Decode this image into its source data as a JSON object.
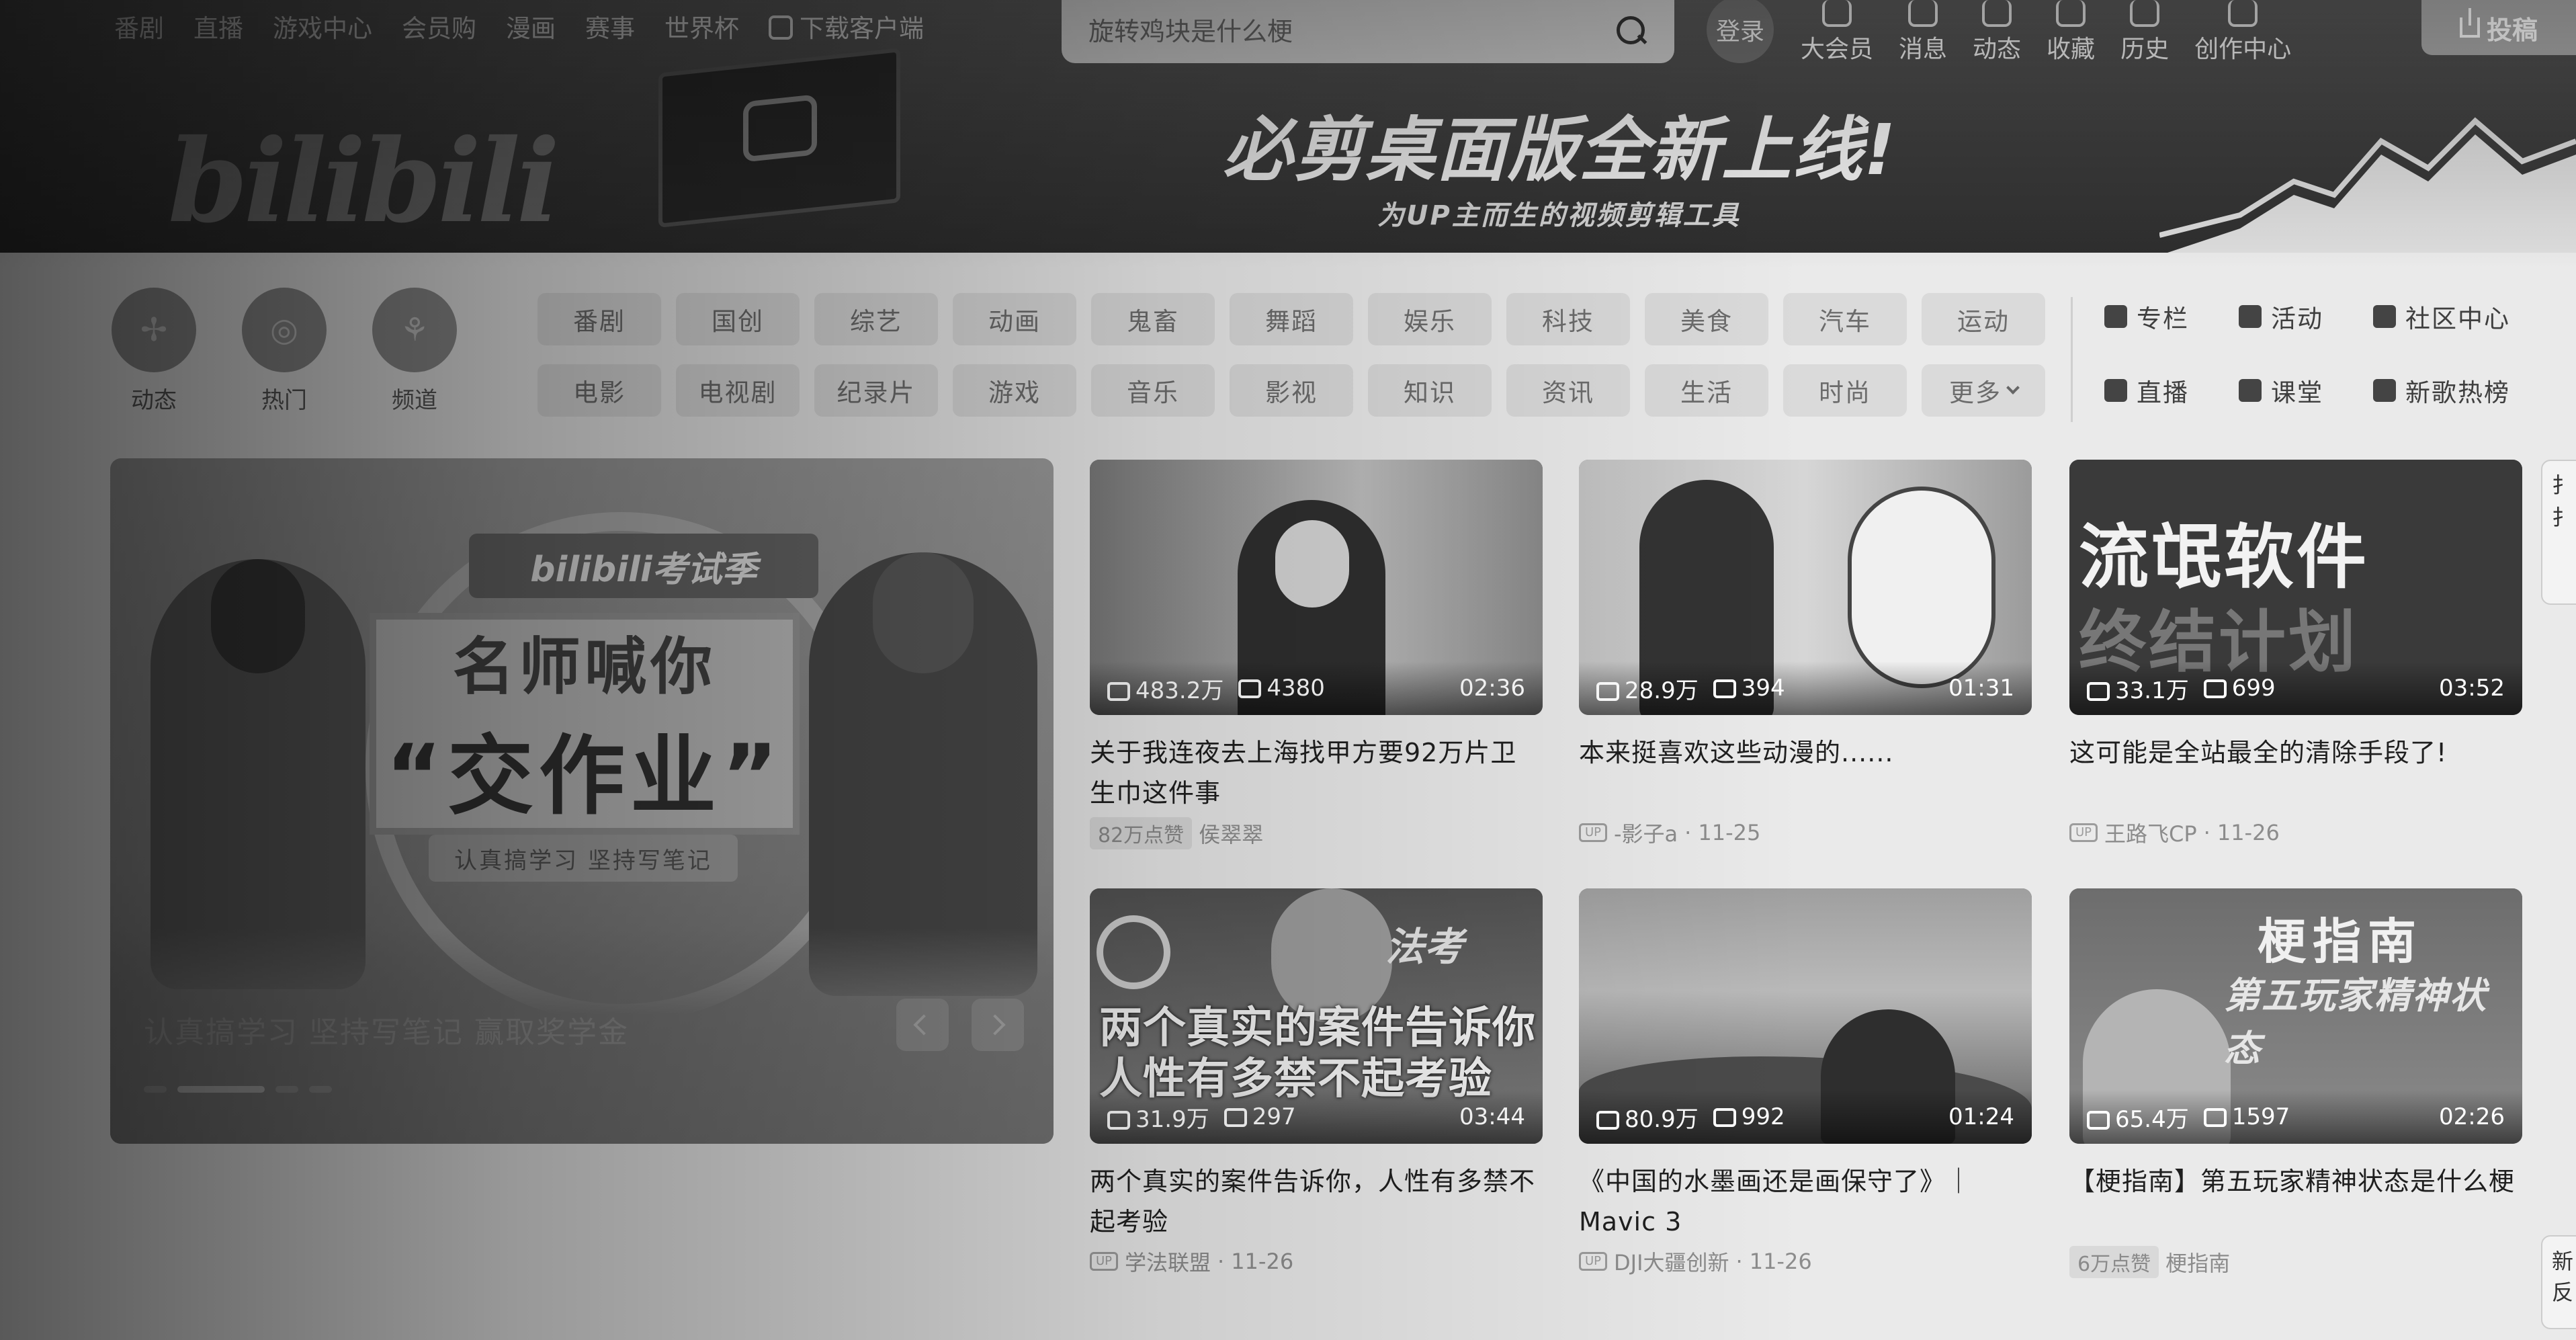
{
  "nav": {
    "links": [
      "番剧",
      "直播",
      "游戏中心",
      "会员购",
      "漫画",
      "赛事",
      "世界杯"
    ],
    "download": "下载客户端",
    "search_placeholder": "旋转鸡块是什么梗",
    "login": "登录",
    "icons": [
      {
        "label": "大会员",
        "icon": "vip-icon"
      },
      {
        "label": "消息",
        "icon": "message-icon"
      },
      {
        "label": "动态",
        "icon": "dynamic-icon"
      },
      {
        "label": "收藏",
        "icon": "favorite-icon"
      },
      {
        "label": "历史",
        "icon": "history-icon"
      },
      {
        "label": "创作中心",
        "icon": "creator-icon"
      }
    ],
    "upload": "投稿"
  },
  "banner": {
    "headline": "必剪桌面版全新上线!",
    "subline": "为UP主而生的视频剪辑工具",
    "logo": "bilibili"
  },
  "channels": {
    "circles": [
      "动态",
      "热门",
      "频道"
    ],
    "tags": [
      "番剧",
      "国创",
      "综艺",
      "动画",
      "鬼畜",
      "舞蹈",
      "娱乐",
      "科技",
      "美食",
      "汽车",
      "运动",
      "电影",
      "电视剧",
      "纪录片",
      "游戏",
      "音乐",
      "影视",
      "知识",
      "资讯",
      "生活",
      "时尚",
      "更多"
    ],
    "quick": [
      "专栏",
      "活动",
      "社区中心",
      "直播",
      "课堂",
      "新歌热榜"
    ]
  },
  "carousel": {
    "badge": "bilibili考试季",
    "board_line1": "名师喊你",
    "board_line2": "“交作业”",
    "ribbon": "认真搞学习 坚持写笔记",
    "caption": "认真搞学习 坚持写笔记 赢取奖学金"
  },
  "videos": [
    {
      "plays": "483.2万",
      "danmaku": "4380",
      "duration": "02:36",
      "title": "关于我连夜去上海找甲方要92万片卫生巾这件事",
      "likes": "82万点赞",
      "author": "侯翠翠",
      "date": ""
    },
    {
      "plays": "28.9万",
      "danmaku": "394",
      "duration": "01:31",
      "title": "本来挺喜欢这些动漫的......",
      "likes": "",
      "author": "-影子a",
      "date": "11-25"
    },
    {
      "plays": "33.1万",
      "danmaku": "699",
      "duration": "03:52",
      "title": "这可能是全站最全的清除手段了!",
      "likes": "",
      "author": "王路飞CP",
      "date": "11-26",
      "thumb_line1": "流氓软件",
      "thumb_line2": "终结计划"
    },
    {
      "plays": "31.9万",
      "danmaku": "297",
      "duration": "03:44",
      "title": "两个真实的案件告诉你，人性有多禁不起考验",
      "likes": "",
      "author": "学法联盟",
      "date": "11-26",
      "thumb_tag": "法考",
      "thumb_overlay": "两个真实的案件告诉你 人性有多禁不起考验"
    },
    {
      "plays": "80.9万",
      "danmaku": "992",
      "duration": "01:24",
      "title": "《中国的水墨画还是画保守了》｜Mavic 3",
      "likes": "",
      "author": "DJI大疆创新",
      "date": "11-26"
    },
    {
      "plays": "65.4万",
      "danmaku": "1597",
      "duration": "02:26",
      "title": "【梗指南】第五玩家精神状态是什么梗",
      "likes": "6万点赞",
      "author": "梗指南",
      "date": "",
      "thumb_line1": "梗指南",
      "thumb_line2": "第五玩家精神状态"
    }
  ],
  "edge": {
    "tab1": "扌扌",
    "tab2": "新反"
  }
}
